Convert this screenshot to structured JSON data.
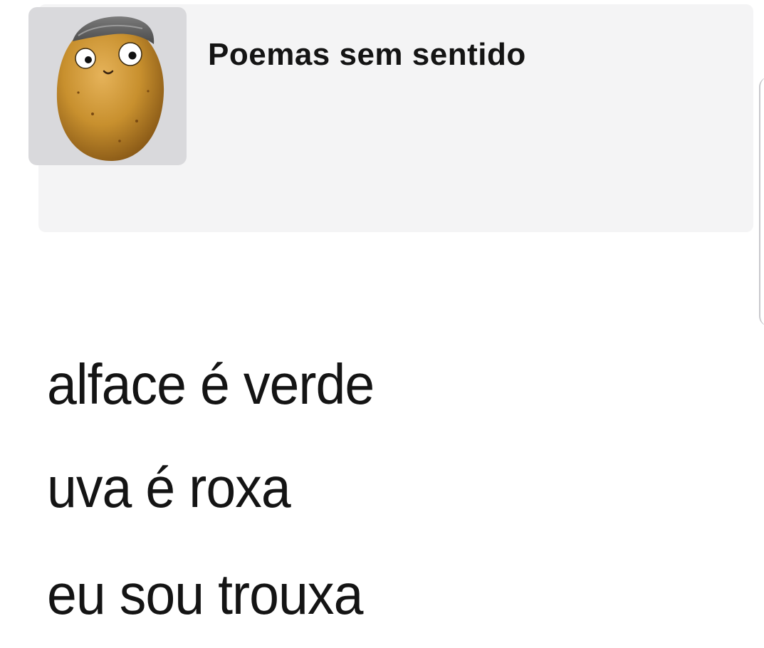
{
  "post": {
    "page_name": "Poemas sem sentido",
    "avatar_icon": "potato-face-icon",
    "poem_lines": [
      "alface é verde",
      "uva é roxa",
      "eu sou trouxa"
    ]
  },
  "colors": {
    "header_background": "#f4f4f5",
    "avatar_background": "#d9d9dc",
    "text": "#141414",
    "potato": "#c8902e"
  }
}
